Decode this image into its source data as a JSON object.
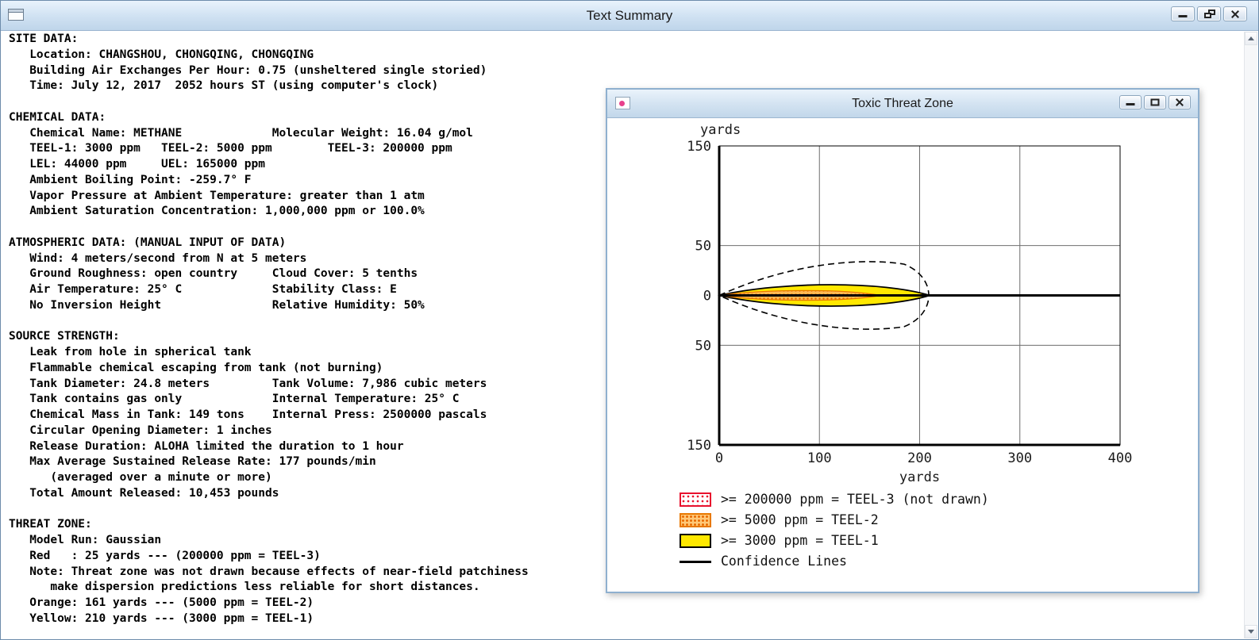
{
  "main_window": {
    "title": "Text Summary"
  },
  "plot_window": {
    "title": "Toxic Threat Zone"
  },
  "report": {
    "lines": [
      "SITE DATA:",
      "   Location: CHANGSHOU, CHONGQING, CHONGQING",
      "   Building Air Exchanges Per Hour: 0.75 (unsheltered single storied)",
      "   Time: July 12, 2017  2052 hours ST (using computer's clock)",
      "",
      "CHEMICAL DATA:",
      "   Chemical Name: METHANE             Molecular Weight: 16.04 g/mol",
      "   TEEL-1: 3000 ppm   TEEL-2: 5000 ppm        TEEL-3: 200000 ppm",
      "   LEL: 44000 ppm     UEL: 165000 ppm",
      "   Ambient Boiling Point: -259.7° F",
      "   Vapor Pressure at Ambient Temperature: greater than 1 atm",
      "   Ambient Saturation Concentration: 1,000,000 ppm or 100.0%",
      "",
      "ATMOSPHERIC DATA: (MANUAL INPUT OF DATA)",
      "   Wind: 4 meters/second from N at 5 meters",
      "   Ground Roughness: open country     Cloud Cover: 5 tenths",
      "   Air Temperature: 25° C             Stability Class: E",
      "   No Inversion Height                Relative Humidity: 50%",
      "",
      "SOURCE STRENGTH:",
      "   Leak from hole in spherical tank",
      "   Flammable chemical escaping from tank (not burning)",
      "   Tank Diameter: 24.8 meters         Tank Volume: 7,986 cubic meters",
      "   Tank contains gas only             Internal Temperature: 25° C",
      "   Chemical Mass in Tank: 149 tons    Internal Press: 2500000 pascals",
      "   Circular Opening Diameter: 1 inches",
      "   Release Duration: ALOHA limited the duration to 1 hour",
      "   Max Average Sustained Release Rate: 177 pounds/min",
      "      (averaged over a minute or more)",
      "   Total Amount Released: 10,453 pounds",
      "",
      "THREAT ZONE:",
      "   Model Run: Gaussian",
      "   Red   : 25 yards --- (200000 ppm = TEEL-3)",
      "   Note: Threat zone was not drawn because effects of near-field patchiness",
      "      make dispersion predictions less reliable for short distances.",
      "   Orange: 161 yards --- (5000 ppm = TEEL-2)",
      "   Yellow: 210 yards --- (3000 ppm = TEEL-1)"
    ]
  },
  "chart_data": {
    "type": "area",
    "title": "Toxic Threat Zone",
    "xlabel": "yards",
    "ylabel": "yards",
    "xlim": [
      0,
      400
    ],
    "ylim": [
      -150,
      150
    ],
    "x_ticks": [
      0,
      100,
      200,
      300,
      400
    ],
    "x_tick_labels": [
      "0",
      "100",
      "200",
      "300",
      "400"
    ],
    "y_ticks": [
      150,
      50,
      0,
      -50,
      -150
    ],
    "y_tick_labels": [
      "150",
      "50",
      "0",
      "50",
      "150"
    ],
    "grid": true,
    "legend_position": "below-left",
    "series": [
      {
        "name": "TEEL-3 threat zone",
        "legend": ">= 200000 ppm = TEEL-3 (not drawn)",
        "threshold_ppm": 200000,
        "downwind_extent_yards": 25,
        "drawn": false,
        "color": "#e8112d",
        "swatch": "red-stipple"
      },
      {
        "name": "TEEL-2 threat zone",
        "legend": ">= 5000 ppm = TEEL-2",
        "threshold_ppm": 5000,
        "downwind_extent_yards": 161,
        "max_half_width_yards": 5,
        "drawn": true,
        "color": "#e87800",
        "swatch": "orange-stipple"
      },
      {
        "name": "TEEL-1 threat zone",
        "legend": ">= 3000 ppm = TEEL-1",
        "threshold_ppm": 3000,
        "downwind_extent_yards": 210,
        "max_half_width_yards": 11,
        "drawn": true,
        "color": "#ffe800",
        "swatch": "yellow-solid"
      },
      {
        "name": "Confidence Lines",
        "legend": "Confidence Lines",
        "downwind_extent_yards": 205,
        "max_half_width_yards": 33,
        "drawn": true,
        "style": "dashed",
        "color": "#000000",
        "swatch": "black-line"
      }
    ]
  }
}
